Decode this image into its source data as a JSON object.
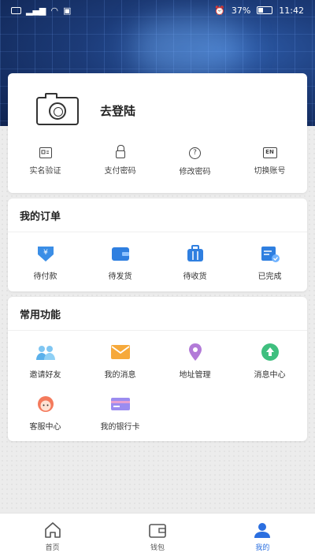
{
  "status_bar": {
    "battery": "37%",
    "time": "11:42"
  },
  "profile": {
    "login_label": "去登陆",
    "quick_actions": [
      {
        "label": "实名验证",
        "icon": "id-card-icon"
      },
      {
        "label": "支付密码",
        "icon": "lock-icon"
      },
      {
        "label": "修改密码",
        "icon": "question-circle-icon"
      },
      {
        "label": "切换账号",
        "icon": "switch-account-icon",
        "glyph": "EN"
      }
    ]
  },
  "orders": {
    "title": "我的订单",
    "items": [
      {
        "label": "待付款",
        "icon": "pending-payment-icon"
      },
      {
        "label": "待发货",
        "icon": "wallet-icon"
      },
      {
        "label": "待收货",
        "icon": "briefcase-icon"
      },
      {
        "label": "已完成",
        "icon": "completed-calendar-icon"
      }
    ]
  },
  "functions": {
    "title": "常用功能",
    "items": [
      {
        "label": "邀请好友",
        "icon": "invite-friends-icon"
      },
      {
        "label": "我的消息",
        "icon": "envelope-icon"
      },
      {
        "label": "地址管理",
        "icon": "location-pin-icon"
      },
      {
        "label": "消息中心",
        "icon": "message-center-icon"
      },
      {
        "label": "客服中心",
        "icon": "customer-service-icon"
      },
      {
        "label": "我的银行卡",
        "icon": "bank-card-icon"
      }
    ]
  },
  "nav": {
    "tabs": [
      {
        "label": "首页",
        "icon": "home-icon"
      },
      {
        "label": "钱包",
        "icon": "wallet-tab-icon"
      },
      {
        "label": "我的",
        "icon": "profile-tab-icon",
        "active": true
      }
    ]
  },
  "colors": {
    "accent": "#2b6fe0",
    "hero": "#1c3b78"
  }
}
